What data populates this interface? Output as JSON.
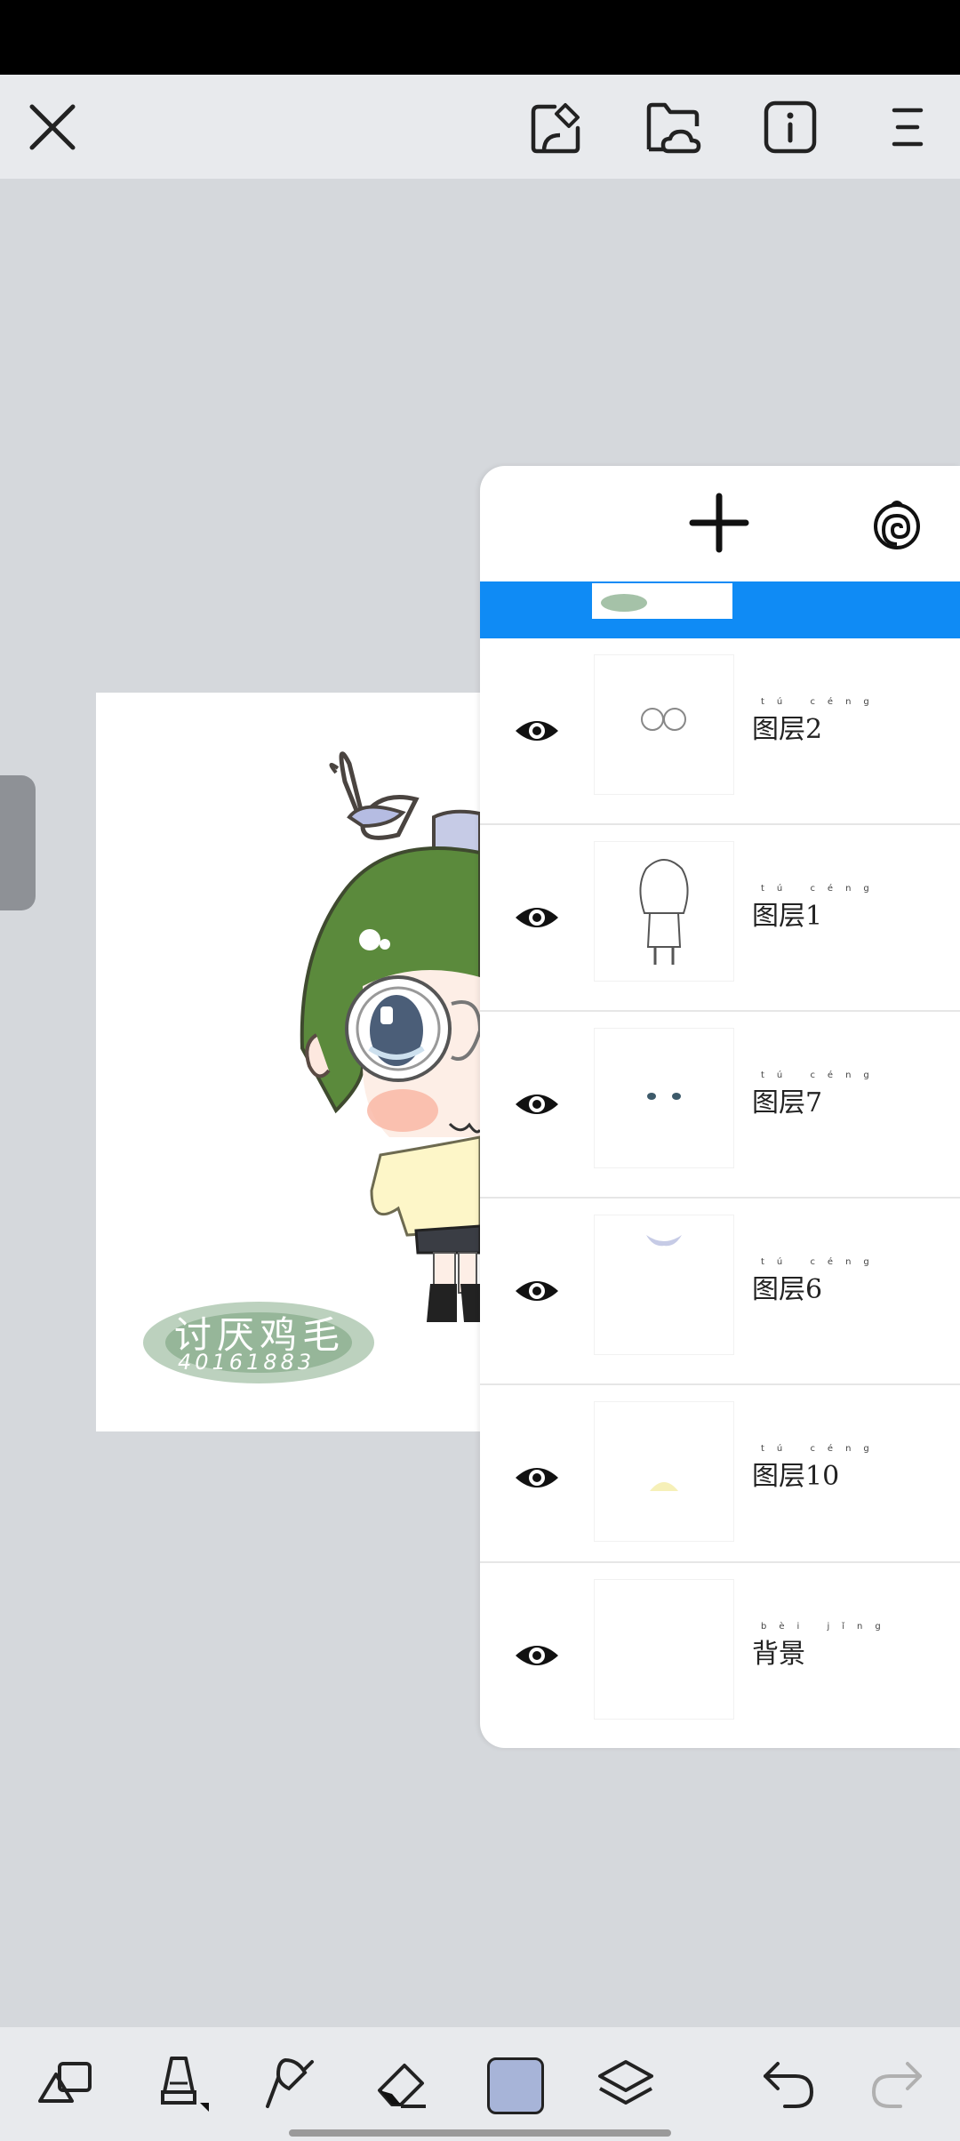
{
  "topbar": {
    "icons": [
      "close-icon",
      "import-icon",
      "cloud-folder-icon",
      "info-icon",
      "menu-icon"
    ]
  },
  "layers_panel": {
    "add_icon": "plus-icon",
    "blend_icon": "spiral-icon",
    "selected_layer": {
      "thumb": "watermark-thumbnail"
    },
    "layers": [
      {
        "name": "图层2",
        "pinyin": "tú céng",
        "visible": true
      },
      {
        "name": "图层1",
        "pinyin": "tú céng",
        "visible": true
      },
      {
        "name": "图层7",
        "pinyin": "tú céng",
        "visible": true
      },
      {
        "name": "图层6",
        "pinyin": "tú céng",
        "visible": true
      },
      {
        "name": "图层10",
        "pinyin": "tú céng",
        "visible": true
      },
      {
        "name": "背景",
        "pinyin": "bèi jǐng",
        "visible": true
      }
    ]
  },
  "artwork": {
    "watermark_line1": "讨厌鸡毛",
    "watermark_line2": "40161883"
  },
  "toolbar": {
    "icons": [
      "shapes-icon",
      "brush-icon",
      "smudge-icon",
      "eraser-icon",
      "color-swatch",
      "layers-icon",
      "undo-icon",
      "redo-icon"
    ],
    "current_color": "#a7b4d8"
  },
  "colors": {
    "accent": "#0f8bf5",
    "hair_green": "#5b8a3c",
    "bg": "#d5d8dc"
  }
}
